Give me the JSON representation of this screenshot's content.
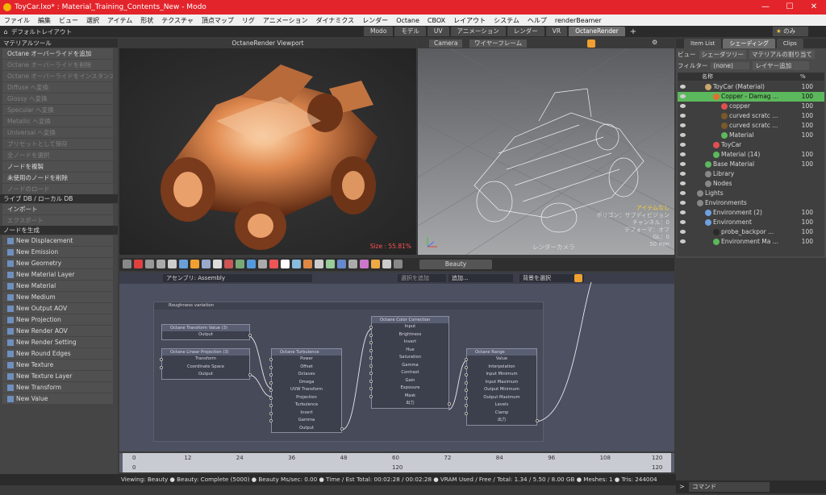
{
  "window": {
    "title": "ToyCar.lxo* : Material_Training_Contents_New - Modo",
    "minimize": "—",
    "maximize": "☐",
    "close": "✕"
  },
  "menu": [
    "ファイル",
    "編集",
    "ビュー",
    "選択",
    "アイテム",
    "形状",
    "テクスチャ",
    "頂点マップ",
    "リグ",
    "アニメーション",
    "ダイナミクス",
    "レンダー",
    "Octane",
    "CBOX",
    "レイアウト",
    "システム",
    "ヘルプ",
    "renderBeamer"
  ],
  "layout": {
    "label": "デフォルトレイアウト",
    "tabs": [
      "Modo",
      "モデル",
      "UV",
      "アニメーション",
      "レンダー",
      "VR",
      "OctaneRender"
    ],
    "active_tab": "OctaneRender",
    "add": "+",
    "only_label": "のみ"
  },
  "left": {
    "sections": [
      {
        "title": "マテリアルツール",
        "items": [
          {
            "label": "Octane オーバーライドを追加",
            "enabled": true
          },
          {
            "label": "Octane オーバーライドを削除",
            "enabled": false
          },
          {
            "label": "Octane オーバーライドをインスタンス化",
            "enabled": false
          },
          {
            "label": "Diffuse へ変換",
            "enabled": false
          },
          {
            "label": "Glossy へ変換",
            "enabled": false
          },
          {
            "label": "Specular へ変換",
            "enabled": false
          },
          {
            "label": "Metallic へ変換",
            "enabled": false
          },
          {
            "label": "Universal へ変換",
            "enabled": false
          },
          {
            "label": "プリセットとして保存",
            "enabled": false
          },
          {
            "label": "全ノードを選択",
            "enabled": false
          },
          {
            "label": "ノードを複製",
            "enabled": true
          },
          {
            "label": "未使用のノードを削除",
            "enabled": true
          },
          {
            "label": "ノードのロード",
            "enabled": false
          }
        ]
      },
      {
        "title": "ライブ DB / ローカル DB",
        "items": [
          {
            "label": "インポート",
            "enabled": true
          },
          {
            "label": "エクスポート",
            "enabled": false
          }
        ]
      },
      {
        "title": "ノードを生成",
        "items": [
          {
            "label": "New Displacement",
            "enabled": true
          },
          {
            "label": "New Emission",
            "enabled": true
          },
          {
            "label": "New Geometry",
            "enabled": true
          },
          {
            "label": "New Material Layer",
            "enabled": true
          },
          {
            "label": "New Material",
            "enabled": true
          },
          {
            "label": "New Medium",
            "enabled": true
          },
          {
            "label": "New Output AOV",
            "enabled": true
          },
          {
            "label": "New Projection",
            "enabled": true
          },
          {
            "label": "New Render AOV",
            "enabled": true
          },
          {
            "label": "New Render Setting",
            "enabled": true
          },
          {
            "label": "New Round Edges",
            "enabled": true
          },
          {
            "label": "New Texture",
            "enabled": true
          },
          {
            "label": "New Texture Layer",
            "enabled": true
          },
          {
            "label": "New Transform",
            "enabled": true
          },
          {
            "label": "New Value",
            "enabled": true
          }
        ]
      }
    ]
  },
  "viewport_octane": {
    "title": "OctaneRender Viewport",
    "status": "Size : 55.81%"
  },
  "viewport_wire": {
    "camera_btn": "Camera",
    "mode_btn": "ワイヤーフレーム",
    "info": [
      "アイテムなし",
      "ポリゴン：サブディビジョン",
      "チャンネル：0",
      "デフォーマ：オフ",
      "GL：0",
      "50 mm"
    ],
    "camera_label": "レンダーカメラ"
  },
  "render_toolbar": {
    "pass": "Beauty"
  },
  "node_editor": {
    "assembly": "アセンブリ: Assembly",
    "add_select": "選択を追加",
    "add_menu": "追加...",
    "bg_select": "背景を選択",
    "group_title": "Roughness variation",
    "nodes": [
      {
        "title": "Octane Transform Value (3)",
        "ports": [
          "Output"
        ]
      },
      {
        "title": "Octane Linear Projection (3)",
        "ports": [
          "Transform",
          "Coordinate Space",
          "Output"
        ]
      },
      {
        "title": "Octane Turbulence",
        "ports": [
          "Power",
          "Offset",
          "Octaves",
          "Omega",
          "UVW Transform",
          "Projection",
          "Turbulence",
          "Invert",
          "Gamma",
          "Output"
        ]
      },
      {
        "title": "Octane Color Correction",
        "ports": [
          "Input",
          "Brightness",
          "Invert",
          "Hue",
          "Saturation",
          "Gamma",
          "Contrast",
          "Gain",
          "Exposure",
          "Mask",
          "出力"
        ]
      },
      {
        "title": "Octane Range",
        "ports": [
          "Value",
          "Interpolation",
          "Input Minimum",
          "Input Maximum",
          "Output Minimum",
          "Output Maximum",
          "Levels",
          "Clamp",
          "出力"
        ]
      }
    ]
  },
  "timeline": {
    "ticks": [
      "0",
      "12",
      "24",
      "36",
      "48",
      "60",
      "72",
      "84",
      "96",
      "108",
      "120"
    ],
    "start": "0",
    "end": "120",
    "mid": "120"
  },
  "status": {
    "text": "Viewing: Beauty ● Beauty: Complete (5000) ● Beauty Ms/sec: 0.00 ● Time / Est Total: 00:02:28 / 00:02:28 ● VRAM Used / Free / Total: 1.34 / 5.50 / 8.00 GB ● Meshes: 1 ● Tris: 244004"
  },
  "right": {
    "tabs": [
      "Item List",
      "シェーディング",
      "Clips"
    ],
    "active_tab": "シェーディング",
    "view_label": "ビュー",
    "view_value": "シェーダツリー",
    "assign": "マテリアルの割り当て",
    "filter_label": "フィルター",
    "filter_value": "(none)",
    "add_layer": "レイヤー追加",
    "col_name": "名称",
    "col_pct": "%",
    "rows": [
      {
        "name": "ToyCar (Material)",
        "val": "100",
        "indent": 2,
        "sel": false
      },
      {
        "name": "Copper - Damag ...",
        "val": "100",
        "indent": 3,
        "sel": true
      },
      {
        "name": "copper",
        "val": "100",
        "indent": 4,
        "sel": false
      },
      {
        "name": "curved scratc ...",
        "val": "100",
        "indent": 4,
        "sel": false
      },
      {
        "name": "curved scratc ...",
        "val": "100",
        "indent": 4,
        "sel": false
      },
      {
        "name": "Material",
        "val": "100",
        "indent": 4,
        "sel": false
      },
      {
        "name": "ToyCar",
        "val": "",
        "indent": 3,
        "sel": false
      },
      {
        "name": "Material (14)",
        "val": "100",
        "indent": 3,
        "sel": false
      },
      {
        "name": "Base Material",
        "val": "100",
        "indent": 2,
        "sel": false
      },
      {
        "name": "Library",
        "val": "",
        "indent": 2,
        "sel": false
      },
      {
        "name": "Nodes",
        "val": "",
        "indent": 2,
        "sel": false
      },
      {
        "name": "Lights",
        "val": "",
        "indent": 1,
        "sel": false
      },
      {
        "name": "Environments",
        "val": "",
        "indent": 1,
        "sel": false
      },
      {
        "name": "Environment (2)",
        "val": "100",
        "indent": 2,
        "sel": false
      },
      {
        "name": "Environment",
        "val": "100",
        "indent": 2,
        "sel": false
      },
      {
        "name": "probe_backpor ...",
        "val": "100",
        "indent": 3,
        "sel": false
      },
      {
        "name": "Environment Ma ...",
        "val": "100",
        "indent": 3,
        "sel": false
      }
    ]
  },
  "command": {
    "label": "コマンド"
  },
  "colors": {
    "titlebar": "#e3242b",
    "selection": "#5cb85c",
    "accent": "#f0a030",
    "graph_bg": "#4c5060"
  }
}
